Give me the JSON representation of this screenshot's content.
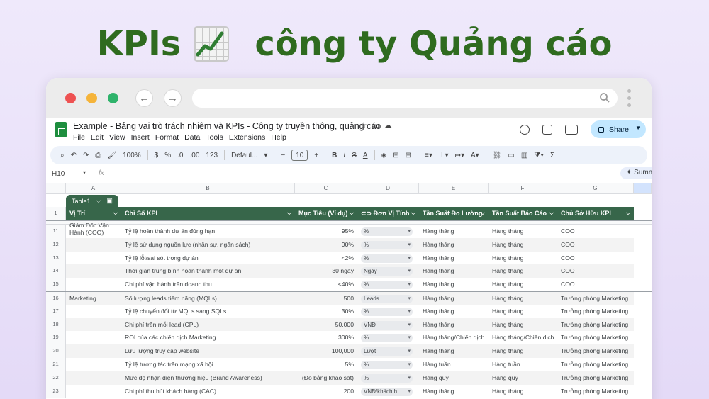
{
  "hero": {
    "left": "KPIs",
    "right": "công ty Quảng cáo"
  },
  "doc": {
    "title": "Example - Bảng vai trò trách nhiệm và KPIs - Công ty truyền thông, quảng cáo",
    "menu": [
      "File",
      "Edit",
      "View",
      "Insert",
      "Format",
      "Data",
      "Tools",
      "Extensions",
      "Help"
    ],
    "share_label": "Share"
  },
  "toolbar": {
    "zoom": "100%",
    "currency": "$",
    "percent": "%",
    "dec_less": ".0",
    "dec_more": ".00",
    "format_123": "123",
    "font": "Defaul...",
    "font_size": "10"
  },
  "formula": {
    "cell_ref": "H10",
    "fx": "fx",
    "summary": "Summa"
  },
  "columns": [
    "A",
    "B",
    "C",
    "D",
    "E",
    "F",
    "G"
  ],
  "table": {
    "name": "Table1",
    "headers": [
      "Vị Trí",
      "Chỉ Số KPI",
      "Mục Tiêu (Ví dụ)",
      "Đơn Vị Tính",
      "Tần Suất Đo Lường",
      "Tần Suất Báo Cáo",
      "Chủ Sở Hữu KPI"
    ],
    "header_row_num": "1",
    "rows": [
      {
        "n": "11",
        "pos": "Giám Đốc Vận Hành (COO)",
        "kpi": "Tỷ lệ hoàn thành dự án đúng hạn",
        "target": "95%",
        "unit": "%",
        "measure": "Hàng tháng",
        "report": "Hàng tháng",
        "owner": "COO"
      },
      {
        "n": "12",
        "pos": "",
        "kpi": "Tỷ lệ sử dụng nguồn lực (nhân sự, ngân sách)",
        "target": "90%",
        "unit": "%",
        "measure": "Hàng tháng",
        "report": "Hàng tháng",
        "owner": "COO"
      },
      {
        "n": "13",
        "pos": "",
        "kpi": "Tỷ lệ lỗi/sai sót trong dự án",
        "target": "<2%",
        "unit": "%",
        "measure": "Hàng tháng",
        "report": "Hàng tháng",
        "owner": "COO"
      },
      {
        "n": "14",
        "pos": "",
        "kpi": "Thời gian trung bình hoàn thành một dự án",
        "target": "30 ngày",
        "unit": "Ngày",
        "measure": "Hàng tháng",
        "report": "Hàng tháng",
        "owner": "COO"
      },
      {
        "n": "15",
        "pos": "",
        "kpi": "Chi phí vận hành trên doanh thu",
        "target": "<40%",
        "unit": "%",
        "measure": "Hàng tháng",
        "report": "Hàng tháng",
        "owner": "COO"
      },
      {
        "n": "16",
        "pos": "Marketing",
        "kpi": "Số lượng leads tiềm năng (MQLs)",
        "target": "500",
        "unit": "Leads",
        "measure": "Hàng tháng",
        "report": "Hàng tháng",
        "owner": "Trưởng phòng Marketing"
      },
      {
        "n": "17",
        "pos": "",
        "kpi": "Tỷ lệ chuyển đổi từ MQLs sang SQLs",
        "target": "30%",
        "unit": "%",
        "measure": "Hàng tháng",
        "report": "Hàng tháng",
        "owner": "Trưởng phòng Marketing"
      },
      {
        "n": "18",
        "pos": "",
        "kpi": "Chi phí trên mỗi lead (CPL)",
        "target": "50,000",
        "unit": "VNĐ",
        "measure": "Hàng tháng",
        "report": "Hàng tháng",
        "owner": "Trưởng phòng Marketing"
      },
      {
        "n": "19",
        "pos": "",
        "kpi": "ROI của các chiến dịch Marketing",
        "target": "300%",
        "unit": "%",
        "measure": "Hàng tháng/Chiến dịch",
        "report": "Hàng tháng/Chiến dịch",
        "owner": "Trưởng phòng Marketing"
      },
      {
        "n": "20",
        "pos": "",
        "kpi": "Lưu lượng truy cập website",
        "target": "100,000",
        "unit": "Lượt",
        "measure": "Hàng tháng",
        "report": "Hàng tháng",
        "owner": "Trưởng phòng Marketing"
      },
      {
        "n": "21",
        "pos": "",
        "kpi": "Tỷ lệ tương tác trên mạng xã hội",
        "target": "5%",
        "unit": "%",
        "measure": "Hàng tuần",
        "report": "Hàng tuần",
        "owner": "Trưởng phòng Marketing"
      },
      {
        "n": "22",
        "pos": "",
        "kpi": "Mức độ nhận diện thương hiệu (Brand Awareness)",
        "target": "(Đo bằng khảo sát)",
        "unit": "%",
        "measure": "Hàng quý",
        "report": "Hàng quý",
        "owner": "Trưởng phòng Marketing"
      },
      {
        "n": "23",
        "pos": "",
        "kpi": "Chi phí thu hút khách hàng (CAC)",
        "target": "200",
        "unit": "VNĐ/khách h...",
        "measure": "Hàng tháng",
        "report": "Hàng tháng",
        "owner": "Trưởng phòng Marketing"
      }
    ]
  }
}
